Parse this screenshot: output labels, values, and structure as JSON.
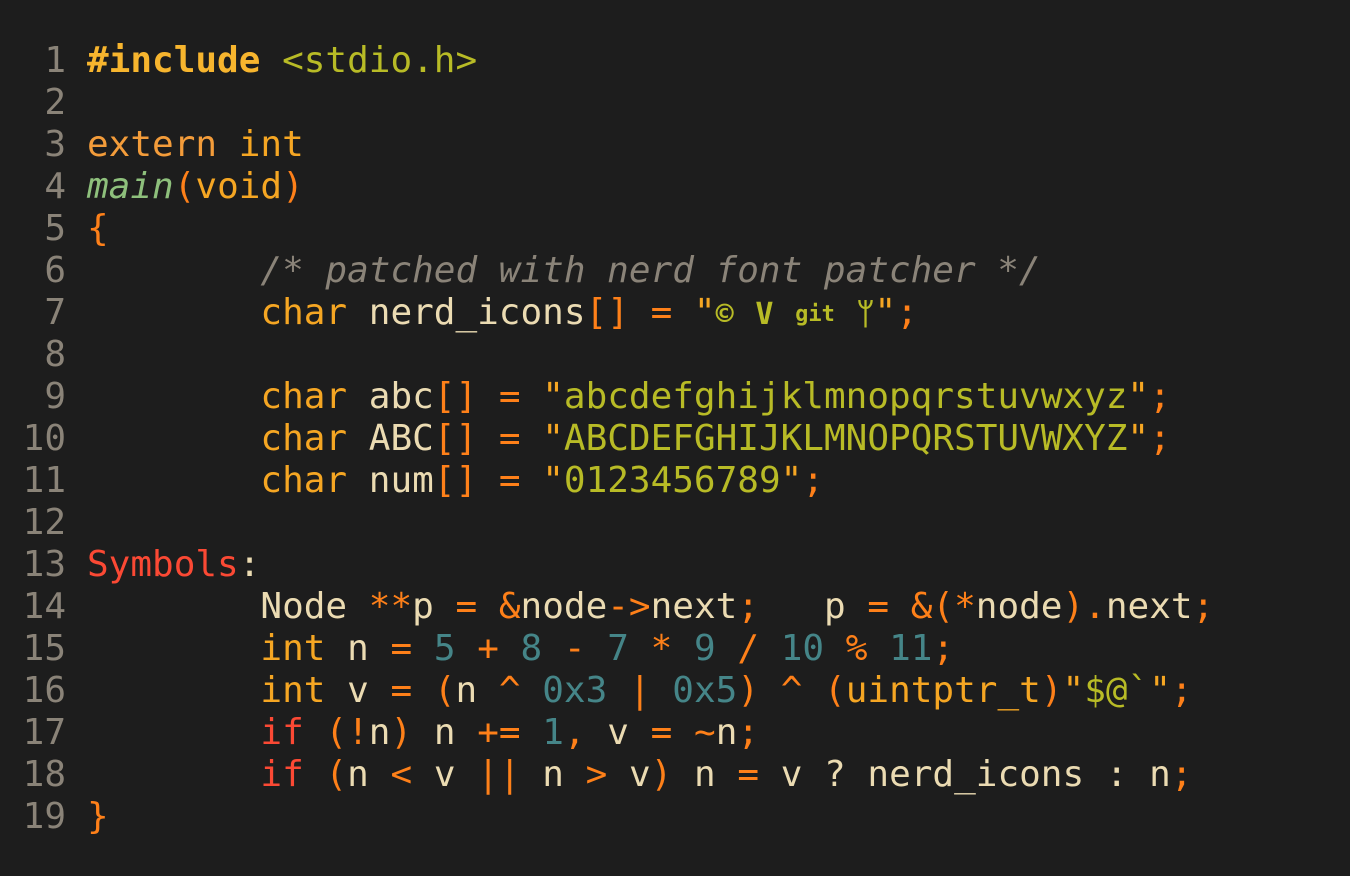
{
  "editor": {
    "lines": [
      {
        "n": "1",
        "tokens": [
          {
            "t": "#include",
            "c": "preproc"
          },
          {
            "t": " ",
            "c": "ident"
          },
          {
            "t": "<stdio.h>",
            "c": "include"
          }
        ]
      },
      {
        "n": "2",
        "tokens": []
      },
      {
        "n": "3",
        "tokens": [
          {
            "t": "extern",
            "c": "kw-orange"
          },
          {
            "t": " ",
            "c": "ident"
          },
          {
            "t": "int",
            "c": "kw-type"
          }
        ]
      },
      {
        "n": "4",
        "tokens": [
          {
            "t": "main",
            "c": "func"
          },
          {
            "t": "(",
            "c": "paren"
          },
          {
            "t": "void",
            "c": "kw-type"
          },
          {
            "t": ")",
            "c": "paren"
          }
        ]
      },
      {
        "n": "5",
        "tokens": [
          {
            "t": "{",
            "c": "brace"
          }
        ]
      },
      {
        "n": "6",
        "tokens": [
          {
            "t": "        /* patched with nerd font patcher */",
            "c": "comment"
          }
        ]
      },
      {
        "n": "7",
        "tokens": [
          {
            "t": "        ",
            "c": "ident"
          },
          {
            "t": "char",
            "c": "kw-type"
          },
          {
            "t": " nerd_icons",
            "c": "ident"
          },
          {
            "t": "[]",
            "c": "punct"
          },
          {
            "t": " ",
            "c": "ident"
          },
          {
            "t": "=",
            "c": "op"
          },
          {
            "t": " \"",
            "c": "strq"
          },
          {
            "t": "ICONS",
            "c": "icons"
          },
          {
            "t": "\"",
            "c": "strq"
          },
          {
            "t": ";",
            "c": "punct"
          }
        ]
      },
      {
        "n": "8",
        "tokens": []
      },
      {
        "n": "9",
        "tokens": [
          {
            "t": "        ",
            "c": "ident"
          },
          {
            "t": "char",
            "c": "kw-type"
          },
          {
            "t": " abc",
            "c": "ident"
          },
          {
            "t": "[]",
            "c": "punct"
          },
          {
            "t": " ",
            "c": "ident"
          },
          {
            "t": "=",
            "c": "op"
          },
          {
            "t": " \"",
            "c": "strq"
          },
          {
            "t": "abcdefghijklmnopqrstuvwxyz",
            "c": "str"
          },
          {
            "t": "\"",
            "c": "strq"
          },
          {
            "t": ";",
            "c": "punct"
          }
        ]
      },
      {
        "n": "10",
        "tokens": [
          {
            "t": "        ",
            "c": "ident"
          },
          {
            "t": "char",
            "c": "kw-type"
          },
          {
            "t": " ABC",
            "c": "ident"
          },
          {
            "t": "[]",
            "c": "punct"
          },
          {
            "t": " ",
            "c": "ident"
          },
          {
            "t": "=",
            "c": "op"
          },
          {
            "t": " \"",
            "c": "strq"
          },
          {
            "t": "ABCDEFGHIJKLMNOPQRSTUVWXYZ",
            "c": "str"
          },
          {
            "t": "\"",
            "c": "strq"
          },
          {
            "t": ";",
            "c": "punct"
          }
        ]
      },
      {
        "n": "11",
        "tokens": [
          {
            "t": "        ",
            "c": "ident"
          },
          {
            "t": "char",
            "c": "kw-type"
          },
          {
            "t": " num",
            "c": "ident"
          },
          {
            "t": "[]",
            "c": "punct"
          },
          {
            "t": " ",
            "c": "ident"
          },
          {
            "t": "=",
            "c": "op"
          },
          {
            "t": " \"",
            "c": "strq"
          },
          {
            "t": "0123456789",
            "c": "str"
          },
          {
            "t": "\"",
            "c": "strq"
          },
          {
            "t": ";",
            "c": "punct"
          }
        ]
      },
      {
        "n": "12",
        "tokens": []
      },
      {
        "n": "13",
        "tokens": [
          {
            "t": "Symbols",
            "c": "label"
          },
          {
            "t": ":",
            "c": "ident"
          }
        ]
      },
      {
        "n": "14",
        "tokens": [
          {
            "t": "        Node ",
            "c": "ident"
          },
          {
            "t": "**",
            "c": "op"
          },
          {
            "t": "p ",
            "c": "ident"
          },
          {
            "t": "=",
            "c": "op"
          },
          {
            "t": " ",
            "c": "ident"
          },
          {
            "t": "&",
            "c": "op"
          },
          {
            "t": "node",
            "c": "ident"
          },
          {
            "t": "->",
            "c": "op"
          },
          {
            "t": "next",
            "c": "ident"
          },
          {
            "t": ";",
            "c": "punct"
          },
          {
            "t": "   p ",
            "c": "ident"
          },
          {
            "t": "=",
            "c": "op"
          },
          {
            "t": " ",
            "c": "ident"
          },
          {
            "t": "&(*",
            "c": "op"
          },
          {
            "t": "node",
            "c": "ident"
          },
          {
            "t": ").",
            "c": "op"
          },
          {
            "t": "next",
            "c": "ident"
          },
          {
            "t": ";",
            "c": "punct"
          }
        ]
      },
      {
        "n": "15",
        "tokens": [
          {
            "t": "        ",
            "c": "ident"
          },
          {
            "t": "int",
            "c": "kw-type"
          },
          {
            "t": " n ",
            "c": "ident"
          },
          {
            "t": "=",
            "c": "op"
          },
          {
            "t": " ",
            "c": "ident"
          },
          {
            "t": "5",
            "c": "num"
          },
          {
            "t": " + ",
            "c": "op"
          },
          {
            "t": "8",
            "c": "num"
          },
          {
            "t": " - ",
            "c": "op"
          },
          {
            "t": "7",
            "c": "num"
          },
          {
            "t": " * ",
            "c": "op"
          },
          {
            "t": "9",
            "c": "num"
          },
          {
            "t": " / ",
            "c": "op"
          },
          {
            "t": "10",
            "c": "num"
          },
          {
            "t": " % ",
            "c": "op"
          },
          {
            "t": "11",
            "c": "num"
          },
          {
            "t": ";",
            "c": "punct"
          }
        ]
      },
      {
        "n": "16",
        "tokens": [
          {
            "t": "        ",
            "c": "ident"
          },
          {
            "t": "int",
            "c": "kw-type"
          },
          {
            "t": " v ",
            "c": "ident"
          },
          {
            "t": "=",
            "c": "op"
          },
          {
            "t": " (",
            "c": "paren"
          },
          {
            "t": "n ",
            "c": "ident"
          },
          {
            "t": "^",
            "c": "op"
          },
          {
            "t": " ",
            "c": "ident"
          },
          {
            "t": "0x3",
            "c": "num"
          },
          {
            "t": " | ",
            "c": "op"
          },
          {
            "t": "0x5",
            "c": "num"
          },
          {
            "t": ")",
            "c": "paren"
          },
          {
            "t": " ^ ",
            "c": "op"
          },
          {
            "t": "(",
            "c": "paren"
          },
          {
            "t": "uintptr_t",
            "c": "kw-type"
          },
          {
            "t": ")",
            "c": "paren"
          },
          {
            "t": "\"",
            "c": "strq"
          },
          {
            "t": "$@`",
            "c": "str"
          },
          {
            "t": "\"",
            "c": "strq"
          },
          {
            "t": ";",
            "c": "punct"
          }
        ]
      },
      {
        "n": "17",
        "tokens": [
          {
            "t": "        ",
            "c": "ident"
          },
          {
            "t": "if",
            "c": "ctrl"
          },
          {
            "t": " (!",
            "c": "paren"
          },
          {
            "t": "n",
            "c": "ident"
          },
          {
            "t": ")",
            "c": "paren"
          },
          {
            "t": " n ",
            "c": "ident"
          },
          {
            "t": "+=",
            "c": "op"
          },
          {
            "t": " ",
            "c": "ident"
          },
          {
            "t": "1",
            "c": "num"
          },
          {
            "t": ",",
            "c": "punct"
          },
          {
            "t": " v ",
            "c": "ident"
          },
          {
            "t": "=",
            "c": "op"
          },
          {
            "t": " ",
            "c": "ident"
          },
          {
            "t": "~",
            "c": "op"
          },
          {
            "t": "n",
            "c": "ident"
          },
          {
            "t": ";",
            "c": "punct"
          }
        ]
      },
      {
        "n": "18",
        "tokens": [
          {
            "t": "        ",
            "c": "ident"
          },
          {
            "t": "if",
            "c": "ctrl"
          },
          {
            "t": " (",
            "c": "paren"
          },
          {
            "t": "n ",
            "c": "ident"
          },
          {
            "t": "<",
            "c": "op"
          },
          {
            "t": " v ",
            "c": "ident"
          },
          {
            "t": "||",
            "c": "op"
          },
          {
            "t": " n ",
            "c": "ident"
          },
          {
            "t": ">",
            "c": "op"
          },
          {
            "t": " v",
            "c": "ident"
          },
          {
            "t": ")",
            "c": "paren"
          },
          {
            "t": " n ",
            "c": "ident"
          },
          {
            "t": "=",
            "c": "op"
          },
          {
            "t": " v ? nerd_icons : n",
            "c": "ident"
          },
          {
            "t": ";",
            "c": "punct"
          }
        ]
      },
      {
        "n": "19",
        "tokens": [
          {
            "t": "}",
            "c": "brace"
          }
        ]
      }
    ],
    "icons": [
      {
        "name": "c-lang-icon",
        "glyph": "©"
      },
      {
        "name": "vim-icon",
        "glyph": "V"
      },
      {
        "name": "git-icon",
        "glyph": "git"
      },
      {
        "name": "git-branch-icon",
        "glyph": "ᛘ"
      }
    ]
  },
  "colors": {
    "background": "#1d1d1d",
    "line_number": "#8a8378",
    "keyword": "#f5a623",
    "operator": "#fe8019",
    "string": "#b8bb26",
    "number": "#458588",
    "label": "#fb4934",
    "function": "#8ec07c",
    "comment": "#8a8378",
    "identifier": "#ebdbb2"
  }
}
